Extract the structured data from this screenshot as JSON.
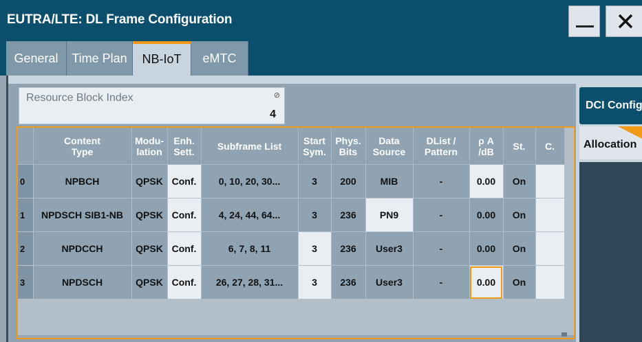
{
  "window": {
    "title": "EUTRA/LTE: DL Frame Configuration"
  },
  "tabs": [
    {
      "label": "General"
    },
    {
      "label": "Time Plan"
    },
    {
      "label": "NB-IoT",
      "active": true
    },
    {
      "label": "eMTC"
    }
  ],
  "resource_block": {
    "label": "Resource Block Index",
    "value": "4"
  },
  "side": {
    "dci_label": "DCI Config",
    "allocation_label": "Allocation"
  },
  "table": {
    "headers": [
      {
        "l1": "",
        "l2": ""
      },
      {
        "l1": "Content",
        "l2": "Type"
      },
      {
        "l1": "Modu-",
        "l2": "lation"
      },
      {
        "l1": "Enh.",
        "l2": "Sett."
      },
      {
        "l1": "Subframe List",
        "l2": ""
      },
      {
        "l1": "Start",
        "l2": "Sym."
      },
      {
        "l1": "Phys.",
        "l2": "Bits"
      },
      {
        "l1": "Data",
        "l2": "Source"
      },
      {
        "l1": "DList /",
        "l2": "Pattern"
      },
      {
        "l1": "ρ A",
        "l2": "/dB"
      },
      {
        "l1": "St.",
        "l2": ""
      },
      {
        "l1": "C.",
        "l2": ""
      }
    ],
    "rows": [
      {
        "idx": "0",
        "content": "NPBCH",
        "mod": "QPSK",
        "enh": "Conf.",
        "subframes": "0, 10, 20, 30...",
        "start": "3",
        "bits": "200",
        "source": "MIB",
        "dlist": "-",
        "rho": "0.00",
        "state": "On",
        "c": ""
      },
      {
        "idx": "1",
        "content": "NPDSCH SIB1-NB",
        "mod": "QPSK",
        "enh": "Conf.",
        "subframes": "4, 24, 44, 64...",
        "start": "3",
        "bits": "236",
        "source": "PN9",
        "dlist": "-",
        "rho": "0.00",
        "state": "On",
        "c": ""
      },
      {
        "idx": "2",
        "content": "NPDCCH",
        "mod": "QPSK",
        "enh": "Conf.",
        "subframes": "6, 7, 8, 11",
        "start": "3",
        "bits": "236",
        "source": "User3",
        "dlist": "-",
        "rho": "0.00",
        "state": "On",
        "c": ""
      },
      {
        "idx": "3",
        "content": "NPDSCH",
        "mod": "QPSK",
        "enh": "Conf.",
        "subframes": "26, 27, 28, 31...",
        "start": "3",
        "bits": "236",
        "source": "User3",
        "dlist": "-",
        "rho": "0.00",
        "state": "On",
        "c": ""
      }
    ]
  },
  "colors": {
    "accent": "#f29a15",
    "titlebar": "#0b4f6c",
    "cell": "#8fa3b3",
    "editable_cell": "#e9eef2"
  }
}
